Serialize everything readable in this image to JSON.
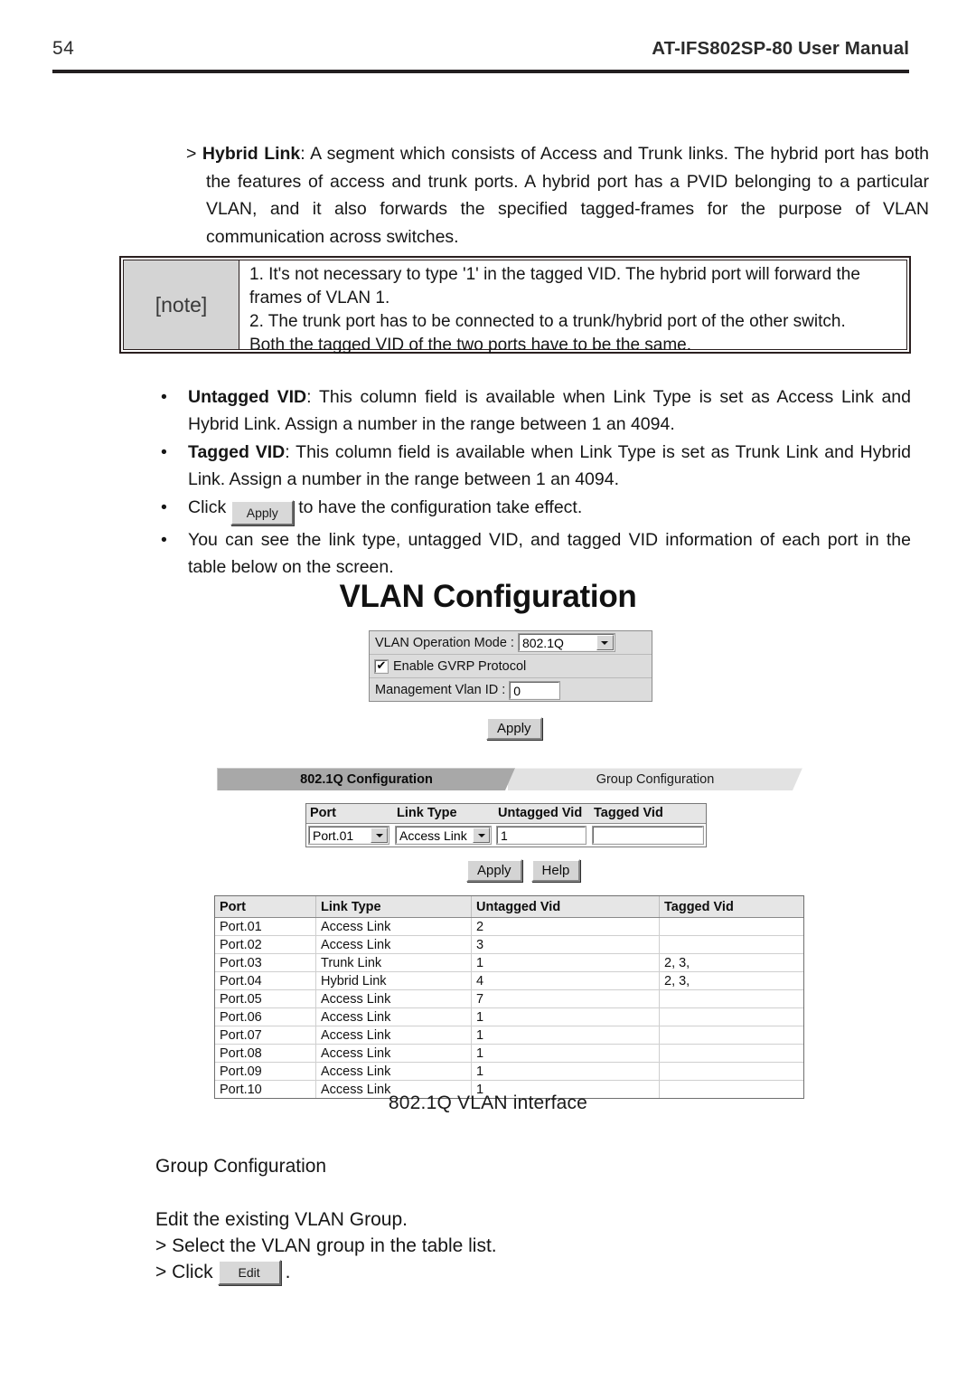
{
  "header": {
    "page_number": "54",
    "manual_title": "AT-IFS802SP-80 User Manual"
  },
  "hybrid_link": {
    "marker": ">",
    "term": "Hybrid Link",
    "body": ": A segment which consists of Access and Trunk links. The hybrid port has both the features of access and trunk ports. A hybrid port has a PVID belonging to a particular VLAN, and it also forwards the specified tagged-frames for the purpose of VLAN communication across switches."
  },
  "note": {
    "label": "[note]",
    "lines": [
      "1.  It's not necessary to type '1' in the tagged VID. The hybrid port will forward the",
      "frames of VLAN 1.",
      "2. The trunk port has to be connected to a trunk/hybrid port of the other switch.",
      "Both the tagged VID of the two ports have to be the same."
    ]
  },
  "bullets": {
    "dot": "•",
    "untagged": {
      "term": "Untagged VID",
      "body": ": This column field is available when Link Type is set as Access Link and Hybrid Link. Assign a number in the range between 1 an 4094."
    },
    "tagged": {
      "term": "Tagged VID",
      "body": ": This column field is available when Link Type is set as Trunk Link and Hybrid Link. Assign a number in the range between 1 an 4094."
    },
    "apply": {
      "prefix": "Click",
      "button_label": "Apply",
      "suffix": "to have the configuration take effect."
    },
    "table_info": "You can see the link type, untagged VID, and tagged VID information of each port in the table below on the screen."
  },
  "screenshot": {
    "title": "VLAN Configuration",
    "panel": {
      "operation_mode_label": "VLAN Operation Mode :",
      "operation_mode_value": "802.1Q",
      "gvrp_label": "Enable GVRP Protocol",
      "gvrp_checked": "✔",
      "mgmt_vlan_label": "Management Vlan ID :",
      "mgmt_vlan_value": "0"
    },
    "apply_button": "Apply",
    "tabs": [
      {
        "label": "802.1Q Configuration",
        "active": true
      },
      {
        "label": "Group Configuration",
        "active": false
      }
    ],
    "edit_form": {
      "headers": [
        "Port",
        "Link Type",
        "Untagged Vid",
        "Tagged Vid"
      ],
      "port_value": "Port.01",
      "link_type_value": "Access Link",
      "untagged_value": "1",
      "tagged_value": ""
    },
    "form_buttons": [
      "Apply",
      "Help"
    ],
    "table": {
      "headers": [
        "Port",
        "Link Type",
        "Untagged Vid",
        "Tagged Vid"
      ],
      "rows": [
        [
          "Port.01",
          "Access Link",
          "2",
          ""
        ],
        [
          "Port.02",
          "Access Link",
          "3",
          ""
        ],
        [
          "Port.03",
          "Trunk Link",
          "1",
          "2, 3,"
        ],
        [
          "Port.04",
          "Hybrid Link",
          "4",
          "2, 3,"
        ],
        [
          "Port.05",
          "Access Link",
          "7",
          ""
        ],
        [
          "Port.06",
          "Access Link",
          "1",
          ""
        ],
        [
          "Port.07",
          "Access Link",
          "1",
          ""
        ],
        [
          "Port.08",
          "Access Link",
          "1",
          ""
        ],
        [
          "Port.09",
          "Access Link",
          "1",
          ""
        ],
        [
          "Port.10",
          "Access Link",
          "1",
          ""
        ]
      ]
    },
    "caption": "802.1Q VLAN interface"
  },
  "closing": {
    "heading": "Group Configuration",
    "line1": "Edit the existing VLAN Group.",
    "line2": "> Select the VLAN group in the table list.",
    "line3_prefix": "> Click",
    "line3_button": "Edit",
    "line3_suffix": "."
  }
}
